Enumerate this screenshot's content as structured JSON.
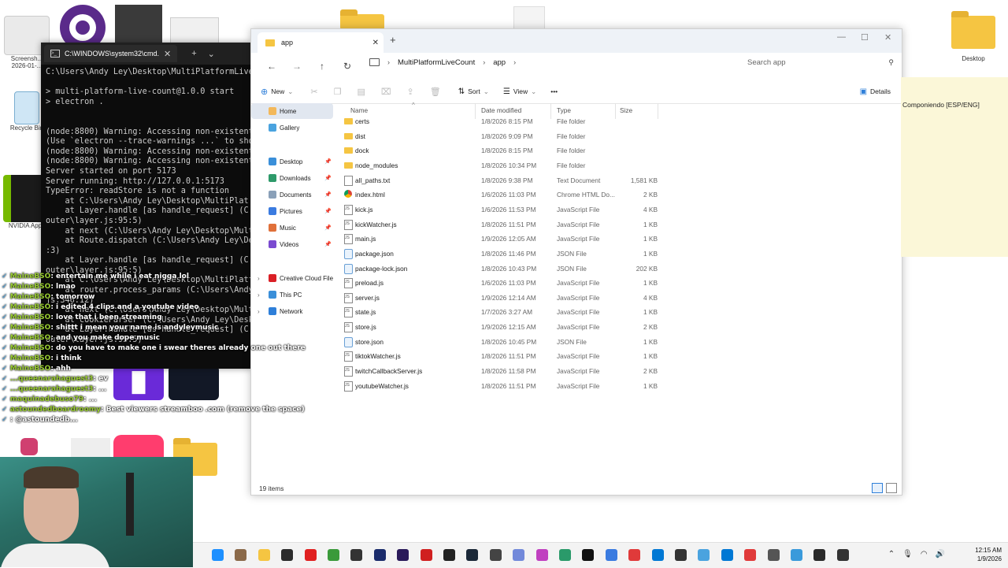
{
  "desktop": {
    "icons": [
      {
        "label": "Screensh... 2026-01-..."
      },
      {
        "label": "Recycle Bin"
      },
      {
        "label": "NVIDIA App"
      },
      {
        "label": "Desktop"
      }
    ]
  },
  "cmd": {
    "title": "C:\\WINDOWS\\system32\\cmd.",
    "lines": [
      "C:\\Users\\Andy Ley\\Desktop\\MultiPlatformLiveC",
      "",
      "> multi-platform-live-count@1.0.0 start",
      "> electron .",
      "",
      "",
      "(node:8800) Warning: Accessing non-existent",
      "(Use `electron --trace-warnings ...` to show",
      "(node:8800) Warning: Accessing non-existent",
      "(node:8800) Warning: Accessing non-existent",
      "Server started on port 5173",
      "Server running: http://127.0.0.1:5173",
      "TypeError: readStore is not a function",
      "    at C:\\Users\\Andy Ley\\Desktop\\MultiPlat",
      "    at Layer.handle [as handle_request] (C:\\",
      "outer\\layer.js:95:5)",
      "    at next (C:\\Users\\Andy Ley\\Desktop\\Mult",
      "    at Route.dispatch (C:\\Users\\Andy Ley\\De",
      ":3)",
      "    at Layer.handle [as handle_request] (C:\\",
      "outer\\layer.js:95:5)",
      "    at C:\\Users\\Andy Ley\\Desktop\\MultiPlatf",
      "    at router.process_params (C:\\Users\\Andy",
      "js:346:12)",
      "    at next (C:\\Users\\Andy Ley\\Desktop\\Mult",
      "    at cookieParser (C:\\Users\\Andy Ley\\Deskt",
      "    at Layer.handle [as handle_request] (C:\\",
      "outer\\layer.js:95:5)"
    ]
  },
  "chat": [
    {
      "user": "MaineBSO",
      "text": "entertain me while i eat nigga lol"
    },
    {
      "user": "MaineBSO",
      "text": "lmao"
    },
    {
      "user": "MaineBSO",
      "text": "tomorrow"
    },
    {
      "user": "MaineBSO",
      "text": "i edited 4 clips and a youtube video"
    },
    {
      "user": "MaineBSO",
      "text": "love that i been streaming"
    },
    {
      "user": "MaineBSO",
      "text": "shittt i mean your name is andyleymusic"
    },
    {
      "user": "MaineBSO",
      "text": "and you make dope music"
    },
    {
      "user": "MaineBSO",
      "text": "do you have to make one i swear theres already one out there"
    },
    {
      "user": "MaineBSO",
      "text": "i think"
    },
    {
      "user": "MaineBSO",
      "text": "ahh"
    },
    {
      "user": "...queenarahaguest3",
      "text": "ev"
    },
    {
      "user": "...queenarahaguest3",
      "text": "..."
    },
    {
      "user": "maquinadebuso79",
      "text": "..."
    },
    {
      "user": "astoundedboardroomy",
      "text": "Best viewers streamboo .com (remove the space)"
    },
    {
      "user": "",
      "text": "@astoundedb..."
    }
  ],
  "explorer": {
    "tab_title": "app",
    "breadcrumb": [
      "MultiPlatformLiveCount",
      "app"
    ],
    "search_placeholder": "Search app",
    "toolbar": {
      "new": "New",
      "sort": "Sort",
      "view": "View",
      "more": "•••",
      "details": "Details"
    },
    "nav": {
      "home": "Home",
      "gallery": "Gallery",
      "desktop": "Desktop",
      "downloads": "Downloads",
      "documents": "Documents",
      "pictures": "Pictures",
      "music": "Music",
      "videos": "Videos",
      "creative_cloud": "Creative Cloud Files",
      "this_pc": "This PC",
      "network": "Network"
    },
    "columns": {
      "name": "Name",
      "date": "Date modified",
      "type": "Type",
      "size": "Size"
    },
    "files": [
      {
        "name": "certs",
        "date": "1/8/2026 8:15 PM",
        "type": "File folder",
        "size": "",
        "icon": "folder"
      },
      {
        "name": "dist",
        "date": "1/8/2026 9:09 PM",
        "type": "File folder",
        "size": "",
        "icon": "folder"
      },
      {
        "name": "dock",
        "date": "1/8/2026 8:15 PM",
        "type": "File folder",
        "size": "",
        "icon": "folder"
      },
      {
        "name": "node_modules",
        "date": "1/8/2026 10:34 PM",
        "type": "File folder",
        "size": "",
        "icon": "folder"
      },
      {
        "name": "all_paths.txt",
        "date": "1/8/2026 9:38 PM",
        "type": "Text Document",
        "size": "1,581 KB",
        "icon": "txt"
      },
      {
        "name": "index.html",
        "date": "1/6/2026 11:03 PM",
        "type": "Chrome HTML Do...",
        "size": "2 KB",
        "icon": "html"
      },
      {
        "name": "kick.js",
        "date": "1/6/2026 11:53 PM",
        "type": "JavaScript File",
        "size": "4 KB",
        "icon": "js"
      },
      {
        "name": "kickWatcher.js",
        "date": "1/8/2026 11:51 PM",
        "type": "JavaScript File",
        "size": "1 KB",
        "icon": "js"
      },
      {
        "name": "main.js",
        "date": "1/9/2026 12:05 AM",
        "type": "JavaScript File",
        "size": "1 KB",
        "icon": "js"
      },
      {
        "name": "package.json",
        "date": "1/8/2026 11:46 PM",
        "type": "JSON File",
        "size": "1 KB",
        "icon": "json"
      },
      {
        "name": "package-lock.json",
        "date": "1/8/2026 10:43 PM",
        "type": "JSON File",
        "size": "202 KB",
        "icon": "json"
      },
      {
        "name": "preload.js",
        "date": "1/6/2026 11:03 PM",
        "type": "JavaScript File",
        "size": "1 KB",
        "icon": "js"
      },
      {
        "name": "server.js",
        "date": "1/9/2026 12:14 AM",
        "type": "JavaScript File",
        "size": "4 KB",
        "icon": "js"
      },
      {
        "name": "state.js",
        "date": "1/7/2026 3:27 AM",
        "type": "JavaScript File",
        "size": "1 KB",
        "icon": "js"
      },
      {
        "name": "store.js",
        "date": "1/9/2026 12:15 AM",
        "type": "JavaScript File",
        "size": "2 KB",
        "icon": "js"
      },
      {
        "name": "store.json",
        "date": "1/8/2026 10:45 PM",
        "type": "JSON File",
        "size": "1 KB",
        "icon": "json"
      },
      {
        "name": "tiktokWatcher.js",
        "date": "1/8/2026 11:51 PM",
        "type": "JavaScript File",
        "size": "1 KB",
        "icon": "js"
      },
      {
        "name": "twitchCallbackServer.js",
        "date": "1/8/2026 11:58 PM",
        "type": "JavaScript File",
        "size": "2 KB",
        "icon": "js"
      },
      {
        "name": "youtubeWatcher.js",
        "date": "1/8/2026 11:51 PM",
        "type": "JavaScript File",
        "size": "1 KB",
        "icon": "js"
      }
    ],
    "status": "19 items"
  },
  "note": {
    "text": "Componiendo [ESP/ENG]"
  },
  "taskbar": {
    "time": "12:15 AM",
    "date": "1/9/2026",
    "icon_colors": [
      "#1e90ff",
      "#8b6a4a",
      "#f5c542",
      "#2b2b2b",
      "#e02020",
      "#3a9a3a",
      "#333333",
      "#1a2b6b",
      "#2a1a5a",
      "#d02020",
      "#222222",
      "#1b2838",
      "#444444",
      "#7289da",
      "#c040c0",
      "#2a9a6a",
      "#111111",
      "#3a7be0",
      "#e03a3a",
      "#0078d4",
      "#333333",
      "#4aa3df",
      "#0078d4",
      "#e03a3a",
      "#555555",
      "#3a9adb",
      "#2a2a2a",
      "#333333"
    ]
  }
}
